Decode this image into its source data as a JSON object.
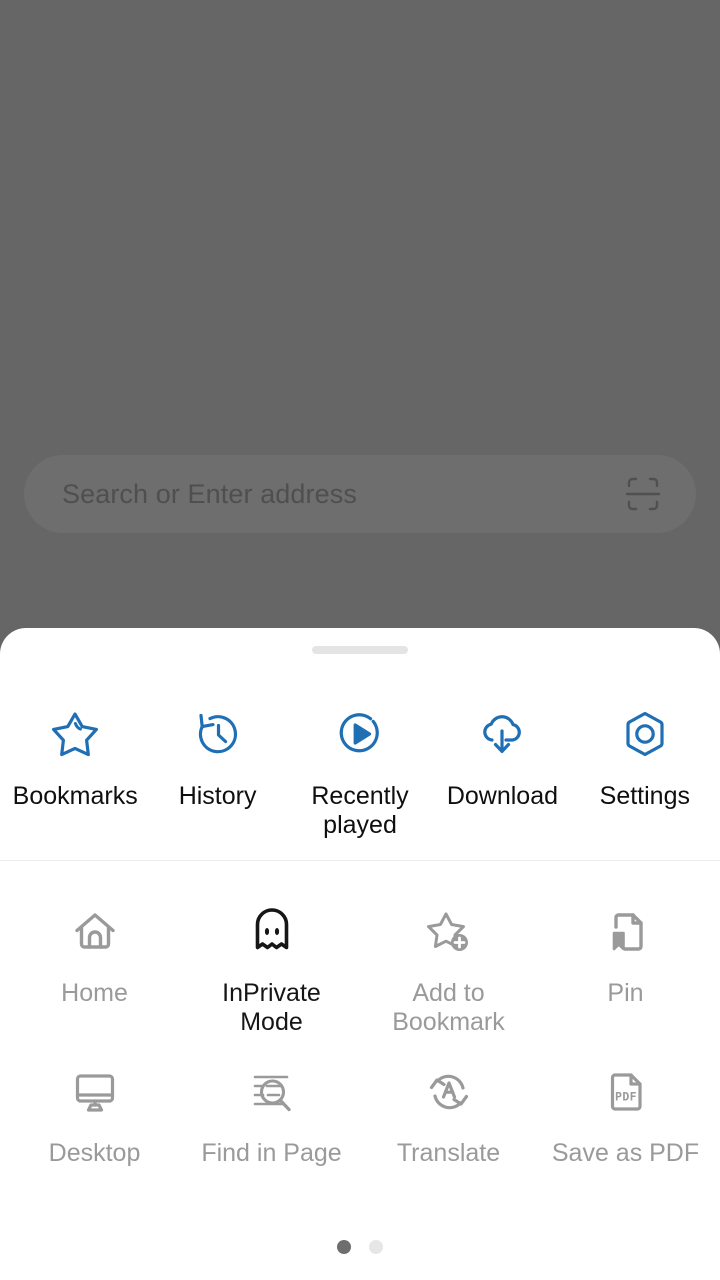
{
  "browser": {
    "address_bar": {
      "placeholder": "Search or Enter address",
      "value": "",
      "scan_icon": "qr-scan-icon"
    }
  },
  "menu_sheet": {
    "drag_handle": "drag-handle",
    "quick_actions": [
      {
        "label": "Bookmarks",
        "icon": "star-bookmark-icon",
        "color": "#1f6fb4",
        "enabled": true
      },
      {
        "label": "History",
        "icon": "clock-history-icon",
        "color": "#1f6fb4",
        "enabled": true
      },
      {
        "label": "Recently played",
        "icon": "play-circle-icon",
        "color": "#1f6fb4",
        "enabled": true
      },
      {
        "label": "Download",
        "icon": "cloud-download-icon",
        "color": "#1f6fb4",
        "enabled": true
      },
      {
        "label": "Settings",
        "icon": "hex-gear-icon",
        "color": "#1f6fb4",
        "enabled": true
      }
    ],
    "grid_rows": [
      [
        {
          "label": "Home",
          "icon": "home-icon",
          "enabled": false
        },
        {
          "label": "InPrivate Mode",
          "icon": "ghost-incognito-icon",
          "enabled": true
        },
        {
          "label": "Add to Bookmark",
          "icon": "star-plus-icon",
          "enabled": false
        },
        {
          "label": "Pin",
          "icon": "pin-page-icon",
          "enabled": false
        }
      ],
      [
        {
          "label": "Desktop",
          "icon": "desktop-monitor-icon",
          "enabled": false
        },
        {
          "label": "Find in Page",
          "icon": "find-in-page-icon",
          "enabled": false
        },
        {
          "label": "Translate",
          "icon": "translate-icon",
          "enabled": false
        },
        {
          "label": "Save as PDF",
          "icon": "pdf-file-icon",
          "enabled": false
        }
      ]
    ],
    "pagination": {
      "total": 2,
      "active_index": 0,
      "active_color": "#6e6e6e",
      "inactive_color": "#e6e6e6"
    }
  },
  "theme": {
    "accent_blue": "#1f6fb4",
    "scrim": "#666666",
    "sheet_background": "#ffffff",
    "disabled_text": "#9a9a9a",
    "enabled_text": "#161616"
  }
}
